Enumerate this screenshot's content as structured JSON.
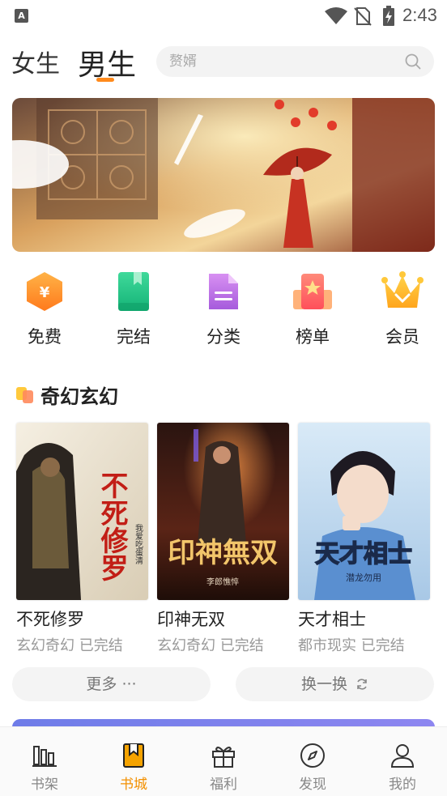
{
  "status_bar": {
    "time": "2:43",
    "app_badge": "A"
  },
  "header": {
    "tabs": [
      {
        "label": "女生",
        "active": false
      },
      {
        "label": "男生",
        "active": true
      }
    ],
    "search": {
      "placeholder": "赘婿"
    }
  },
  "categories": [
    {
      "label": "免费",
      "icon": "yuan-hexagon-icon"
    },
    {
      "label": "完结",
      "icon": "book-bookmark-icon"
    },
    {
      "label": "分类",
      "icon": "document-list-icon"
    },
    {
      "label": "榜单",
      "icon": "ranking-star-icon"
    },
    {
      "label": "会员",
      "icon": "crown-icon"
    }
  ],
  "section": {
    "title": "奇幻玄幻",
    "books": [
      {
        "title": "不死修罗",
        "meta": "玄幻奇幻 已完结",
        "cover_text": "不死修罗",
        "cover_author": "我爱吃蛋清"
      },
      {
        "title": "印神无双",
        "meta": "玄幻奇幻 已完结",
        "cover_text": "印神無双",
        "cover_author": "李郎憔悴"
      },
      {
        "title": "天才相士",
        "meta": "都市现实 已完结",
        "cover_text": "天才相士",
        "cover_author": "潜龙勿用"
      }
    ],
    "more_label": "更多 ···",
    "swap_label": "换一换"
  },
  "bottom_nav": [
    {
      "label": "书架",
      "icon": "bookshelf-icon",
      "active": false
    },
    {
      "label": "书城",
      "icon": "bookstore-icon",
      "active": true
    },
    {
      "label": "福利",
      "icon": "gift-icon",
      "active": false
    },
    {
      "label": "发现",
      "icon": "compass-icon",
      "active": false
    },
    {
      "label": "我的",
      "icon": "user-icon",
      "active": false
    }
  ],
  "colors": {
    "accent": "#f39000",
    "indicator": "#ff8a1c"
  }
}
